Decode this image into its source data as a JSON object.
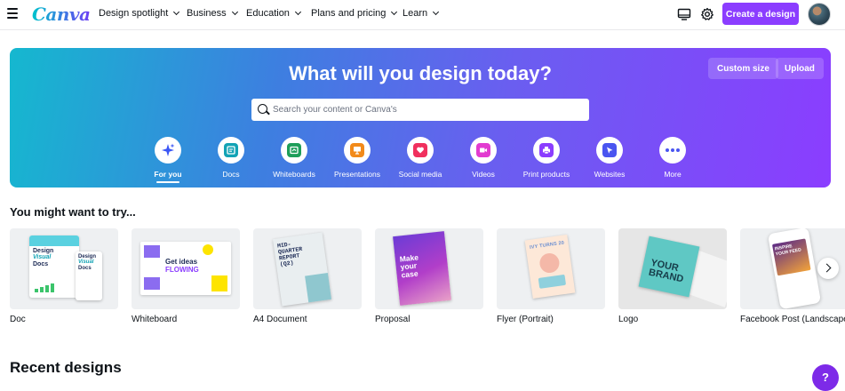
{
  "topbar": {
    "logo": "Canva",
    "nav": [
      "Design spotlight",
      "Business",
      "Education",
      "Plans and pricing",
      "Learn"
    ],
    "create_label": "Create a design"
  },
  "hero": {
    "title": "What will you design today?",
    "custom_size_label": "Custom size",
    "upload_label": "Upload",
    "search_placeholder": "Search your content or Canva's",
    "categories": [
      {
        "label": "For you",
        "icon": "sparkle-icon",
        "color": "#3b56f5",
        "active": true
      },
      {
        "label": "Docs",
        "icon": "doc-icon",
        "color": "#13a3b5"
      },
      {
        "label": "Whiteboards",
        "icon": "whiteboard-icon",
        "color": "#1e9e5a"
      },
      {
        "label": "Presentations",
        "icon": "presentation-icon",
        "color": "#f28a1a"
      },
      {
        "label": "Social media",
        "icon": "heart-icon",
        "color": "#f0305e"
      },
      {
        "label": "Videos",
        "icon": "video-icon",
        "color": "#e23bd0"
      },
      {
        "label": "Print products",
        "icon": "print-icon",
        "color": "#8b3dff"
      },
      {
        "label": "Websites",
        "icon": "cursor-icon",
        "color": "#4a55f0"
      },
      {
        "label": "More",
        "icon": "more-icon",
        "color": "#4a55f0"
      }
    ]
  },
  "try_section": {
    "title": "You might want to try...",
    "cards": [
      {
        "label": "Doc"
      },
      {
        "label": "Whiteboard"
      },
      {
        "label": "A4 Document"
      },
      {
        "label": "Proposal"
      },
      {
        "label": "Flyer (Portrait)"
      },
      {
        "label": "Logo"
      },
      {
        "label": "Facebook Post (Landscape)"
      }
    ],
    "thumb_text": {
      "doc": [
        "Design",
        "Visual",
        "Docs"
      ],
      "whiteboard": [
        "Get ideas",
        "FLOWING"
      ],
      "a4": [
        "MID-",
        "QUARTER",
        "REPORT",
        "(Q2)"
      ],
      "proposal": [
        "Make",
        "your",
        "case"
      ],
      "flyer": "IVY TURNS 20",
      "logo": [
        "YOUR",
        "BRAND"
      ],
      "facebook": [
        "INSPIRE",
        "YOUR FEED"
      ]
    }
  },
  "recent": {
    "title": "Recent designs"
  },
  "help_label": "?",
  "colors": {
    "accent": "#8b3dff",
    "hero_start": "#15b8cf",
    "hero_end": "#8b3dff"
  }
}
